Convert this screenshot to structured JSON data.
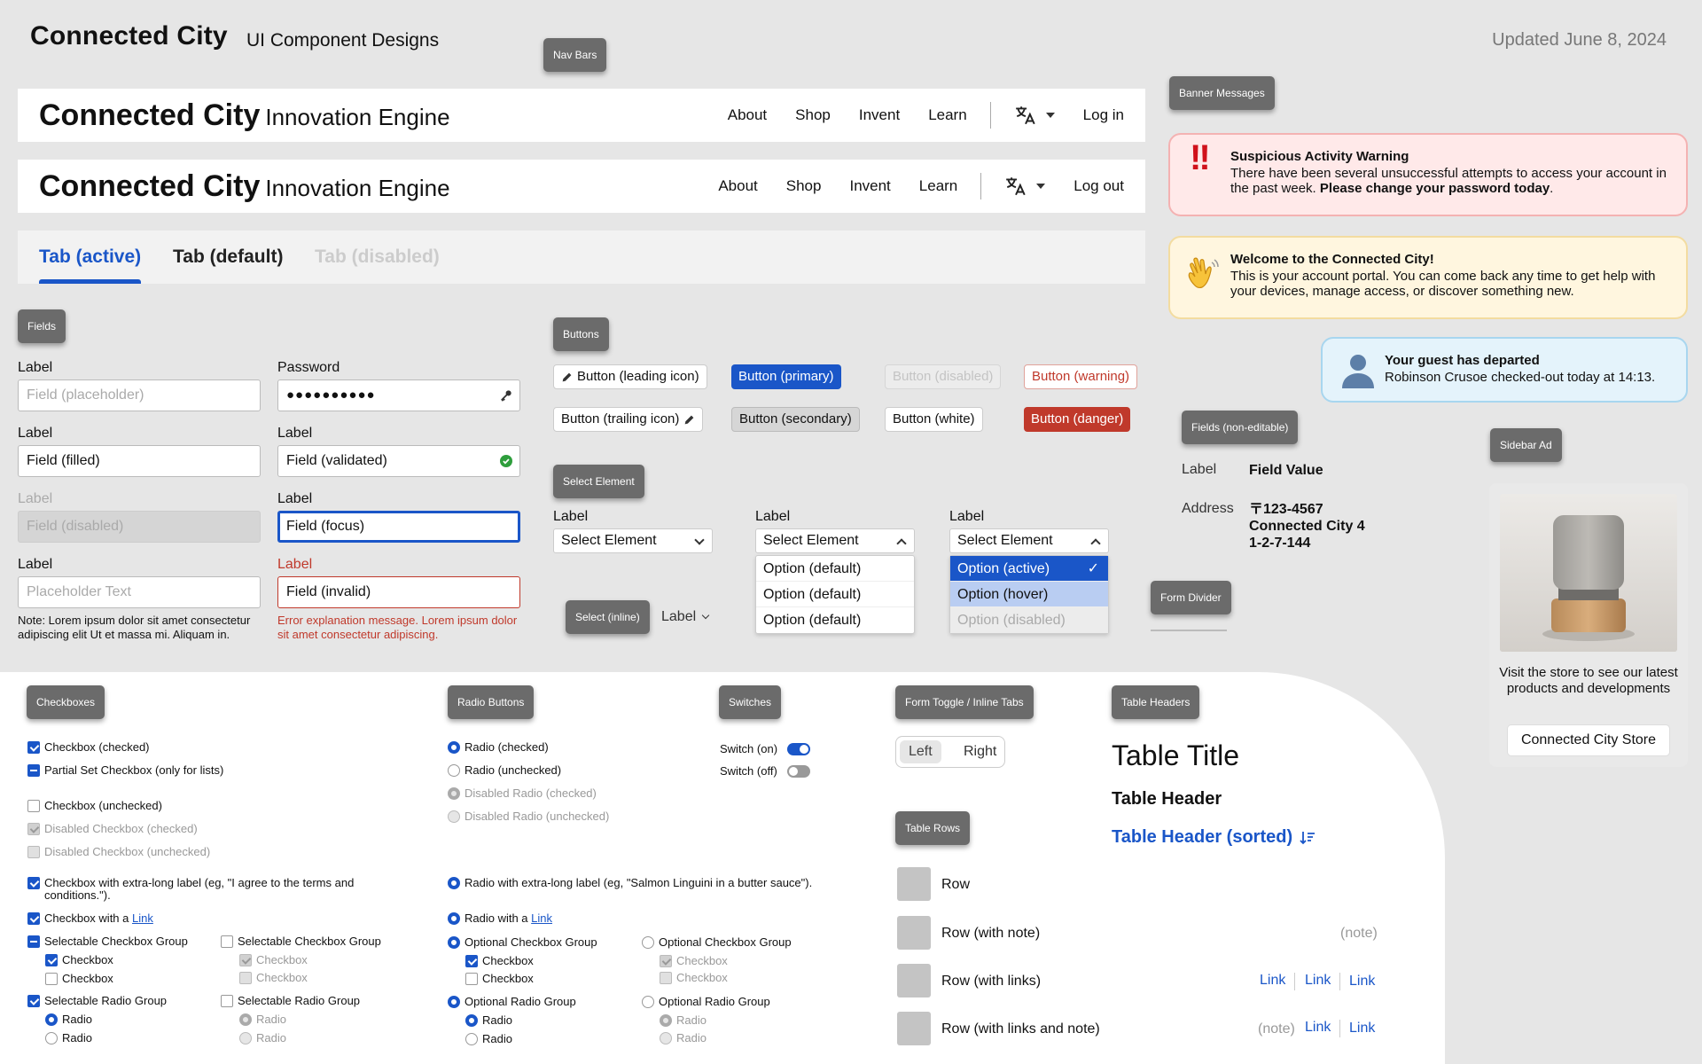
{
  "header": {
    "title": "Connected City",
    "subtitle": "UI Component Designs",
    "updated": "Updated June 8, 2024"
  },
  "tags": {
    "nav_bars": "Nav Bars",
    "banner_messages": "Banner Messages",
    "fields": "Fields",
    "buttons": "Buttons",
    "select_element": "Select Element",
    "select_inline": "Select (inline)",
    "fields_noneditable": "Fields (non-editable)",
    "sidebar_ad": "Sidebar Ad",
    "form_divider": "Form Divider",
    "checkboxes": "Checkboxes",
    "radio_buttons": "Radio Buttons",
    "switches": "Switches",
    "form_toggle": "Form Toggle / Inline Tabs",
    "table_headers": "Table Headers",
    "table_rows": "Table Rows"
  },
  "navbar1": {
    "brand": "Connected City",
    "brand_sub": "Innovation Engine",
    "links": [
      "About",
      "Shop",
      "Invent",
      "Learn"
    ],
    "language_icon": "translate-icon",
    "auth": "Log in"
  },
  "navbar2": {
    "brand": "Connected City",
    "brand_sub": "Innovation Engine",
    "links": [
      "About",
      "Shop",
      "Invent",
      "Learn"
    ],
    "language_icon": "translate-icon",
    "auth": "Log out"
  },
  "tabs": {
    "active": "Tab (active)",
    "default": "Tab (default)",
    "disabled": "Tab (disabled)"
  },
  "fields": {
    "f1_label": "Label",
    "f1_placeholder": "Field (placeholder)",
    "f2_label": "Label",
    "f2_value": "Field (filled)",
    "f3_label": "Label",
    "f3_value": "Field (disabled)",
    "f4_label": "Label",
    "f4_placeholder": "Placeholder Text",
    "note": "Note: Lorem ipsum dolor sit amet consectetur adipiscing elit Ut et massa mi. Aliquam in.",
    "pw_label": "Password",
    "pw_value": "●●●●●●●●●●",
    "f5_label": "Label",
    "f5_value": "Field (validated)",
    "f6_label": "Label",
    "f6_value": "Field (focus)",
    "f7_label": "Label",
    "f7_value": "Field (invalid)",
    "error": "Error explanation message. Lorem ipsum dolor sit amet consectetur adipiscing."
  },
  "buttons": {
    "leading_icon": "Button (leading icon)",
    "primary": "Button (primary)",
    "disabled": "Button (disabled)",
    "warning": "Button (warning)",
    "trailing_icon": "Button (trailing icon)",
    "secondary": "Button (secondary)",
    "white": "Button (white)",
    "danger": "Button (danger)"
  },
  "selects": {
    "s1_label": "Label",
    "s1_value": "Select Element",
    "s2_label": "Label",
    "s2_value": "Select Element",
    "s2_options": [
      "Option (default)",
      "Option (default)",
      "Option (default)"
    ],
    "s3_label": "Label",
    "s3_value": "Select Element",
    "s3_options": [
      "Option (active)",
      "Option (hover)",
      "Option (disabled)"
    ],
    "inline_label": "Label"
  },
  "banners": {
    "warning_title": "Suspicious Activity Warning",
    "warning_text": "There have been several unsuccessful attempts to access your account in the past week. ",
    "warning_bold": "Please change your password today",
    "warning_end": ".",
    "welcome_title": "Welcome to the Connected City!",
    "welcome_text": "This is your account portal. You can come back any time to get help with your devices, manage access, or discover something new.",
    "guest_title": "Your guest has departed",
    "guest_text": "Robinson Crusoe checked-out today at 14:13."
  },
  "noneditable": {
    "label1": "Label",
    "value1": "Field Value",
    "label2": "Address",
    "address_line1": "〒123-4567",
    "address_line2": "Connected City 4",
    "address_line3": "1-2-7-144"
  },
  "ad": {
    "text": "Visit the store to see our latest products and developments",
    "button": "Connected City Store"
  },
  "checkboxes": {
    "checked": "Checkbox (checked)",
    "partial": "Partial Set Checkbox (only for lists)",
    "unchecked": "Checkbox (unchecked)",
    "disabled_checked": "Disabled Checkbox (checked)",
    "disabled_unchecked": "Disabled Checkbox (unchecked)",
    "long_label": "Checkbox with extra-long label (eg, \"I agree to the terms and conditions.\").",
    "with_link_pre": "Checkbox with a ",
    "link": "Link",
    "group_a": "Selectable Checkbox Group",
    "group_b": "Selectable Checkbox Group",
    "item": "Checkbox",
    "radio_group_a": "Selectable Radio Group",
    "radio_group_b": "Selectable Radio Group",
    "radio_item": "Radio"
  },
  "radios": {
    "checked": "Radio (checked)",
    "unchecked": "Radio (unchecked)",
    "disabled_checked": "Disabled Radio (checked)",
    "disabled_unchecked": "Disabled Radio (unchecked)",
    "long_label": "Radio with extra-long label (eg, \"Salmon Linguini in a butter sauce\").",
    "with_link_pre": "Radio with a ",
    "link": "Link",
    "opt_cb_group_a": "Optional Checkbox Group",
    "opt_cb_group_b": "Optional Checkbox Group",
    "cb_item": "Checkbox",
    "opt_radio_group_a": "Optional Radio Group",
    "opt_radio_group_b": "Optional Radio Group",
    "radio_item": "Radio"
  },
  "switches": {
    "on": "Switch (on)",
    "off": "Switch (off)"
  },
  "toggle": {
    "left": "Left",
    "right": "Right"
  },
  "table": {
    "title": "Table Title",
    "header": "Table Header",
    "header_sorted": "Table Header (sorted)",
    "row1": "Row",
    "row2": "Row (with note)",
    "row2_note": "(note)",
    "row3": "Row (with links)",
    "row4": "Row (with links and note)",
    "row4_note": "(note)",
    "link": "Link"
  },
  "colors": {
    "accent": "#1a56c8",
    "danger": "#c0392b",
    "background": "#e6e6e6"
  }
}
